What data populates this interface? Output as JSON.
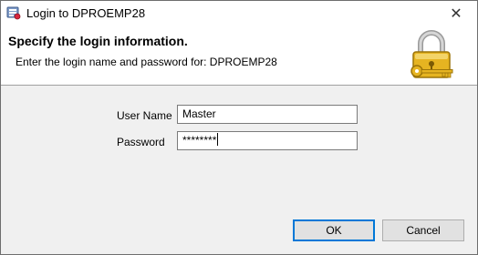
{
  "window": {
    "title": "Login to DPROEMP28",
    "app_icon": "database-app-icon",
    "close_glyph": "✕"
  },
  "header": {
    "title": "Specify the login information.",
    "subtitle": "Enter the login name and password for: DPROEMP28",
    "icon": "padlock-with-key-icon"
  },
  "form": {
    "username_label": "User Name",
    "username_value": "Master",
    "password_label": "Password",
    "password_value": "********"
  },
  "buttons": {
    "ok_label": "OK",
    "cancel_label": "Cancel"
  },
  "colors": {
    "focus_accent": "#0078d7",
    "dialog_background": "#f0f0f0",
    "header_background": "#ffffff",
    "lock_gold": "#e0a81c"
  }
}
